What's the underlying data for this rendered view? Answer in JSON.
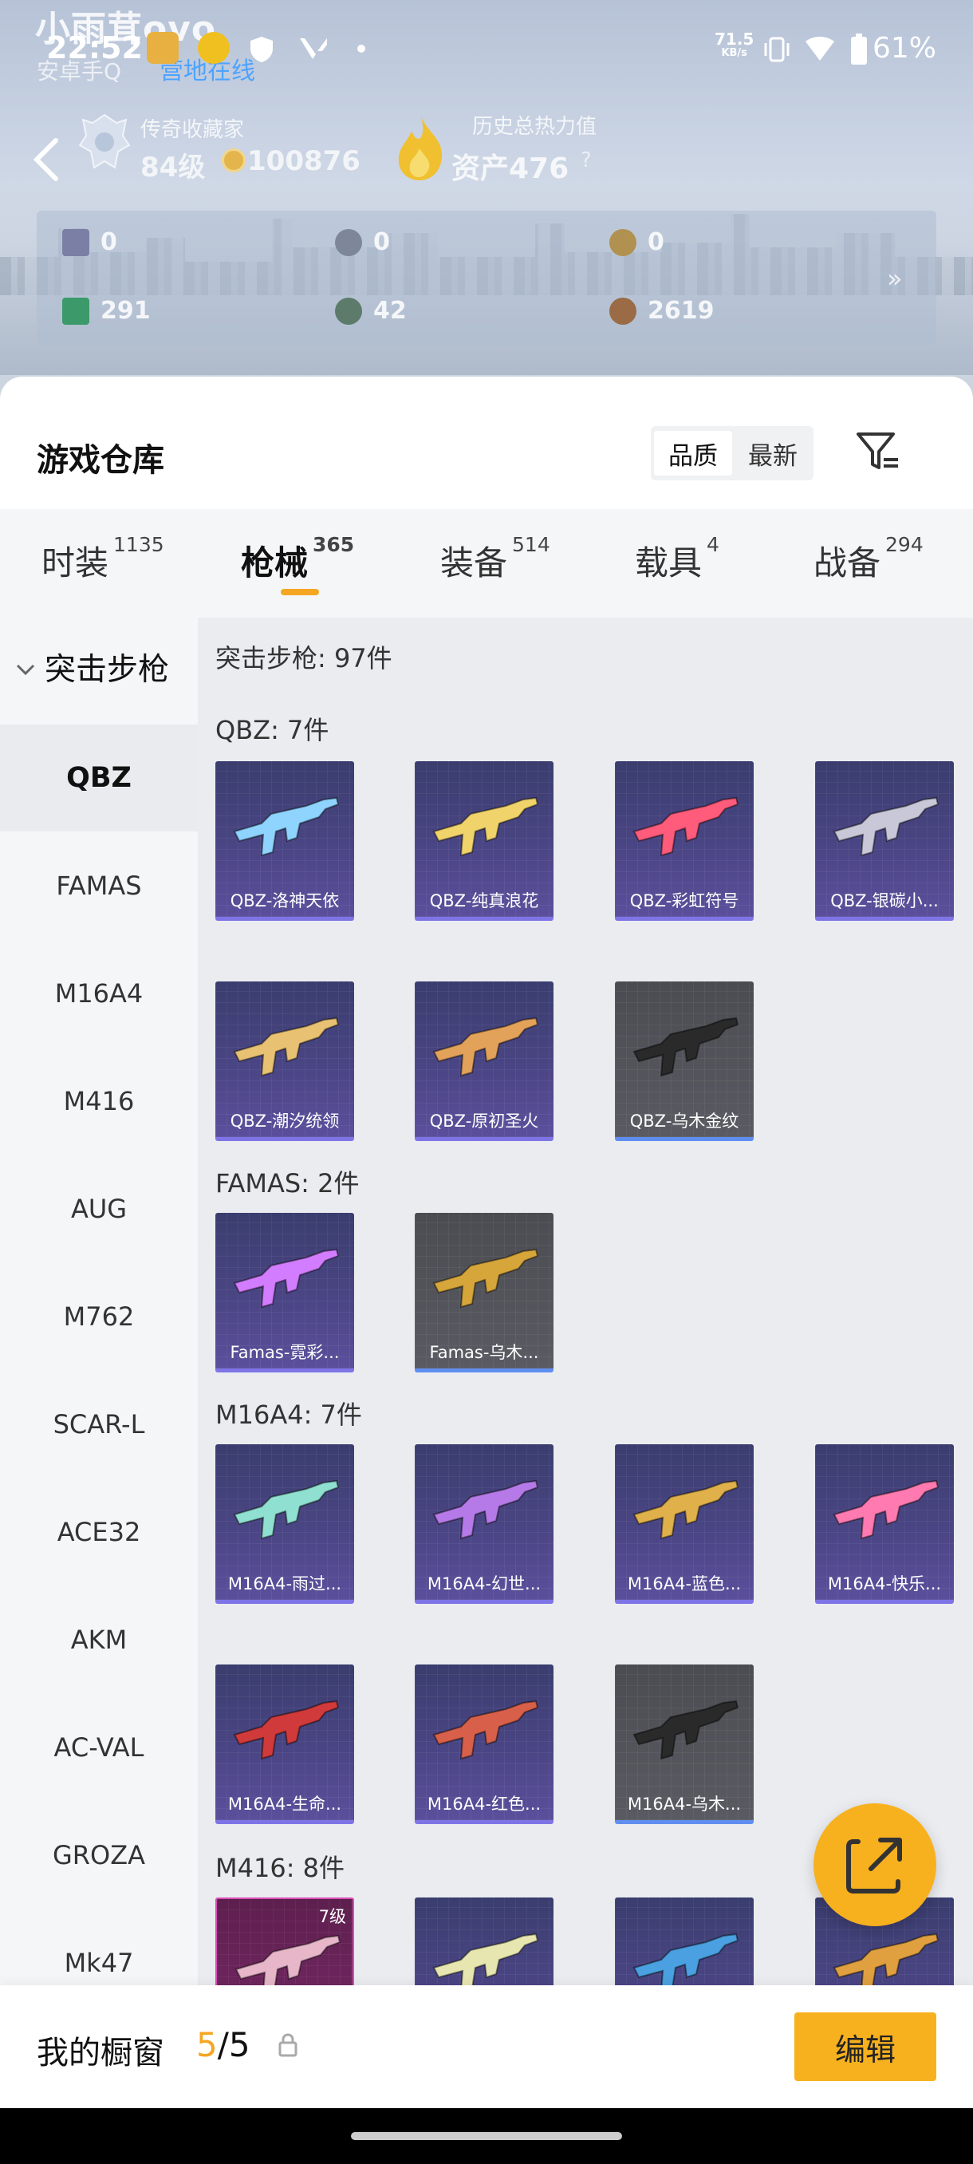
{
  "status_bar": {
    "time": "22:52",
    "net_speed_value": "71.5",
    "net_speed_unit": "KB/s",
    "battery": "61%"
  },
  "profile": {
    "nickname": "小雨茸ovo",
    "subline": "安卓手Q",
    "online_status": "营地在线",
    "collector_title": "传奇收藏家",
    "level": "84级",
    "coins": "100876",
    "heat_title": "历史总热力值",
    "heat_value": "资产476",
    "help": "?"
  },
  "stats": [
    {
      "value": "0",
      "icon": "card-icon",
      "color": "#7b7fa6"
    },
    {
      "value": "0",
      "icon": "silver-coin-icon",
      "color": "#7d8799"
    },
    {
      "value": "0",
      "icon": "gold-coin-icon",
      "color": "#b0914f"
    },
    {
      "value": "291",
      "icon": "green-card-icon",
      "color": "#3c9a6a"
    },
    {
      "value": "42",
      "icon": "grenade-icon",
      "color": "#5c7b6b"
    },
    {
      "value": "2619",
      "icon": "bronze-coin-icon",
      "color": "#9a6b45"
    }
  ],
  "stats_more": "»",
  "warehouse": {
    "title": "游戏仓库",
    "sort_quality": "品质",
    "sort_latest": "最新"
  },
  "tabs": [
    {
      "label": "时装",
      "count": "1135"
    },
    {
      "label": "枪械",
      "count": "365"
    },
    {
      "label": "装备",
      "count": "514"
    },
    {
      "label": "载具",
      "count": "4"
    },
    {
      "label": "战备",
      "count": "294"
    }
  ],
  "sidebar": {
    "category": "突击步枪",
    "items": [
      "QBZ",
      "FAMAS",
      "M16A4",
      "M416",
      "AUG",
      "M762",
      "SCAR-L",
      "ACE32",
      "AKM",
      "AC-VAL",
      "GROZA",
      "Mk47"
    ]
  },
  "content": {
    "category_total": "突击步枪: 97件",
    "sections": [
      {
        "title": "QBZ: 7件",
        "items": [
          {
            "label": "QBZ-洛神天依",
            "style": "purple",
            "gun_color": "#8fd3ff"
          },
          {
            "label": "QBZ-纯真浪花",
            "style": "purple",
            "gun_color": "#f0d36a"
          },
          {
            "label": "QBZ-彩虹符号",
            "style": "purple",
            "gun_color": "#ff5b7a"
          },
          {
            "label": "QBZ-银碳小...",
            "style": "purple",
            "gun_color": "#c8c8d8"
          },
          {
            "label": "QBZ-潮汐统领",
            "style": "purple",
            "gun_color": "#e8c173"
          },
          {
            "label": "QBZ-原初圣火",
            "style": "purple",
            "gun_color": "#e3a25a"
          },
          {
            "label": "QBZ-乌木金纹",
            "style": "gray",
            "gun_color": "#2a2a2a"
          }
        ]
      },
      {
        "title": "FAMAS: 2件",
        "items": [
          {
            "label": "Famas-霓彩...",
            "style": "purple",
            "gun_color": "#d27cff"
          },
          {
            "label": "Famas-乌木...",
            "style": "gray",
            "gun_color": "#d6a63a"
          }
        ]
      },
      {
        "title": "M16A4: 7件",
        "items": [
          {
            "label": "M16A4-雨过...",
            "style": "purple",
            "gun_color": "#8fe0d0"
          },
          {
            "label": "M16A4-幻世...",
            "style": "purple",
            "gun_color": "#b57ae8"
          },
          {
            "label": "M16A4-蓝色...",
            "style": "purple",
            "gun_color": "#e0b04a"
          },
          {
            "label": "M16A4-快乐...",
            "style": "purple",
            "gun_color": "#ff7ab0"
          },
          {
            "label": "M16A4-生命...",
            "style": "purple",
            "gun_color": "#d03a3a"
          },
          {
            "label": "M16A4-红色...",
            "style": "purple",
            "gun_color": "#d8604a"
          },
          {
            "label": "M16A4-乌木...",
            "style": "gray",
            "gun_color": "#2a2a2a"
          }
        ]
      },
      {
        "title": "M416: 8件",
        "items": [
          {
            "label": "",
            "badge": "7级",
            "style": "pink",
            "gun_color": "#e7b6c8"
          },
          {
            "label": "",
            "style": "purple",
            "gun_color": "#e8e6b0"
          },
          {
            "label": "",
            "style": "purple",
            "gun_color": "#4aa0e0"
          },
          {
            "label": "",
            "style": "purple",
            "gun_color": "#e0a040"
          }
        ]
      }
    ]
  },
  "showcase": {
    "label": "我的橱窗",
    "current": "5",
    "total": "/5",
    "edit_label": "编辑"
  }
}
